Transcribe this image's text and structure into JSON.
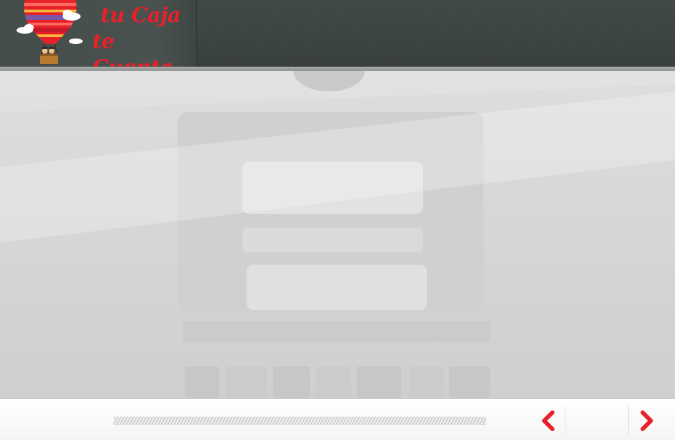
{
  "header": {
    "logo_line1": "tu Caja",
    "logo_line2": "te Cuenta",
    "logo_icon": "hot-air-balloon-icon"
  },
  "colors": {
    "brand_red": "#e8202a",
    "header_bg": "#3b4341",
    "stage_bg": "#d8d8d8",
    "footer_bg": "#f8f8f8"
  },
  "footer": {
    "progress": 0,
    "prev_icon": "chevron-left-icon",
    "next_icon": "chevron-right-icon"
  }
}
